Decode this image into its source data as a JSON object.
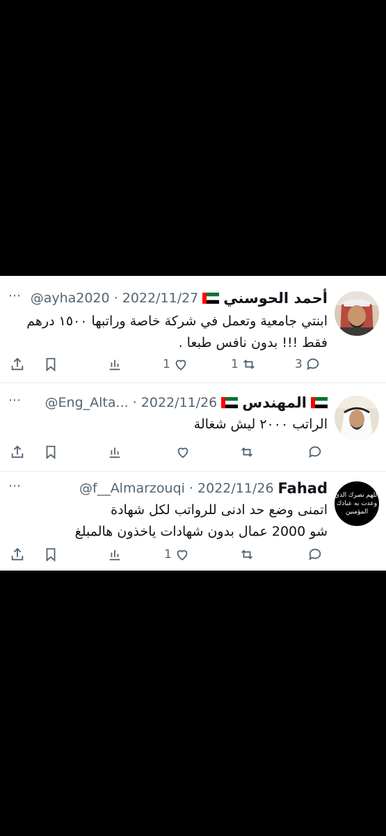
{
  "tweets": [
    {
      "name": "أحمد الحوسني",
      "handle_date": "@ayha2020 · 2022/11/27",
      "text_line1": "ابنتي جامعية وتعمل في شركة خاصة وراتبها ١٥٠٠ درهم",
      "text_line2": "فقط !!! بدون نافس طبعا .",
      "likes": "1",
      "retweets": "1",
      "replies": "3"
    },
    {
      "name": "المهندس",
      "handle_date": "@Eng_Alta... · 2022/11/26",
      "text_line1": "الراتب ٢٠٠٠ ليش شغالة",
      "likes": "",
      "retweets": "",
      "replies": ""
    },
    {
      "name": "Fahad",
      "handle_date": "@f__Almarzouqi · 2022/11/26",
      "text_line1": "اتمنى وضع حد ادنى للرواتب لكل شهادة",
      "text_line2": "شو 2000 عمال بدون شهادات ياخذون هالمبلغ",
      "likes": "1",
      "retweets": "",
      "replies": "",
      "avatar_text_1": "اللهم نصرك الذي",
      "avatar_text_2": "وعدت به عبادك",
      "avatar_text_3": "المؤمنين"
    }
  ],
  "icons": {
    "more": "⋯",
    "colors": {
      "text": "#0f1419",
      "muted": "#536471",
      "divider": "#e6ecf0"
    }
  }
}
